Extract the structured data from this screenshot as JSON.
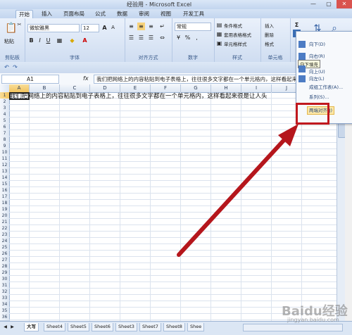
{
  "window": {
    "title": "经验用 - Microsoft Excel",
    "min": "—",
    "max": "▢",
    "close": "✕"
  },
  "tabs": [
    "开始",
    "插入",
    "页面布局",
    "公式",
    "数据",
    "审阅",
    "视图",
    "开发工具"
  ],
  "ribbon": {
    "paste": "粘贴",
    "clipboard_group": "剪贴板",
    "font_name": "微软雅黑",
    "font_size": "12",
    "font_group": "字体",
    "align_group": "对齐方式",
    "number_format": "常规",
    "number_group": "数字",
    "cond_format": "条件格式",
    "table_format": "套用表格格式",
    "cell_style": "单元格样式",
    "style_group": "样式",
    "insert": "插入",
    "delete": "删除",
    "format": "格式",
    "cells_group": "单元格",
    "bold": "B",
    "italic": "I",
    "underline": "U",
    "pct": "%",
    "comma": ","
  },
  "formula_bar": {
    "name_box": "A1",
    "fx": "fx",
    "content": "我们把网络上的内容粘贴到电子表格上，往往很多文字都在一个单元格内，这样看起来很是让人头"
  },
  "columns": [
    "A",
    "B",
    "C",
    "D",
    "E",
    "F",
    "G",
    "H",
    "I",
    "J"
  ],
  "rows": [
    "1",
    "2",
    "3",
    "4",
    "5",
    "6",
    "7",
    "8",
    "9",
    "10",
    "11",
    "12",
    "13",
    "14",
    "15",
    "16",
    "17",
    "18",
    "19",
    "20",
    "21",
    "22",
    "23",
    "24",
    "25",
    "26",
    "27",
    "28",
    "29",
    "30",
    "31",
    "32",
    "33",
    "34",
    "35",
    "36"
  ],
  "cell_a1": "我们把网络上的内容粘贴到电子表格上，往往很多文字都在一个单元格内，这样看起来很是让人头",
  "fill_menu": {
    "items": [
      "向下(D)",
      "向右(R)",
      "向上(U)",
      "向左(L)",
      "成组工作表(A)...",
      "系列(S)...",
      "两端对齐(J)"
    ],
    "tooltip": "向下填充"
  },
  "sheet_tabs": [
    "大写",
    "Sheet4",
    "Sheet5",
    "Sheet6",
    "Sheet3",
    "Sheet7",
    "Sheet8",
    "Shee"
  ],
  "watermark": "Baidu经验",
  "watermark_url": "jingyan.baidu.com",
  "colors": {
    "highlight_box": "#c0181e",
    "arrow": "#b5161c"
  }
}
